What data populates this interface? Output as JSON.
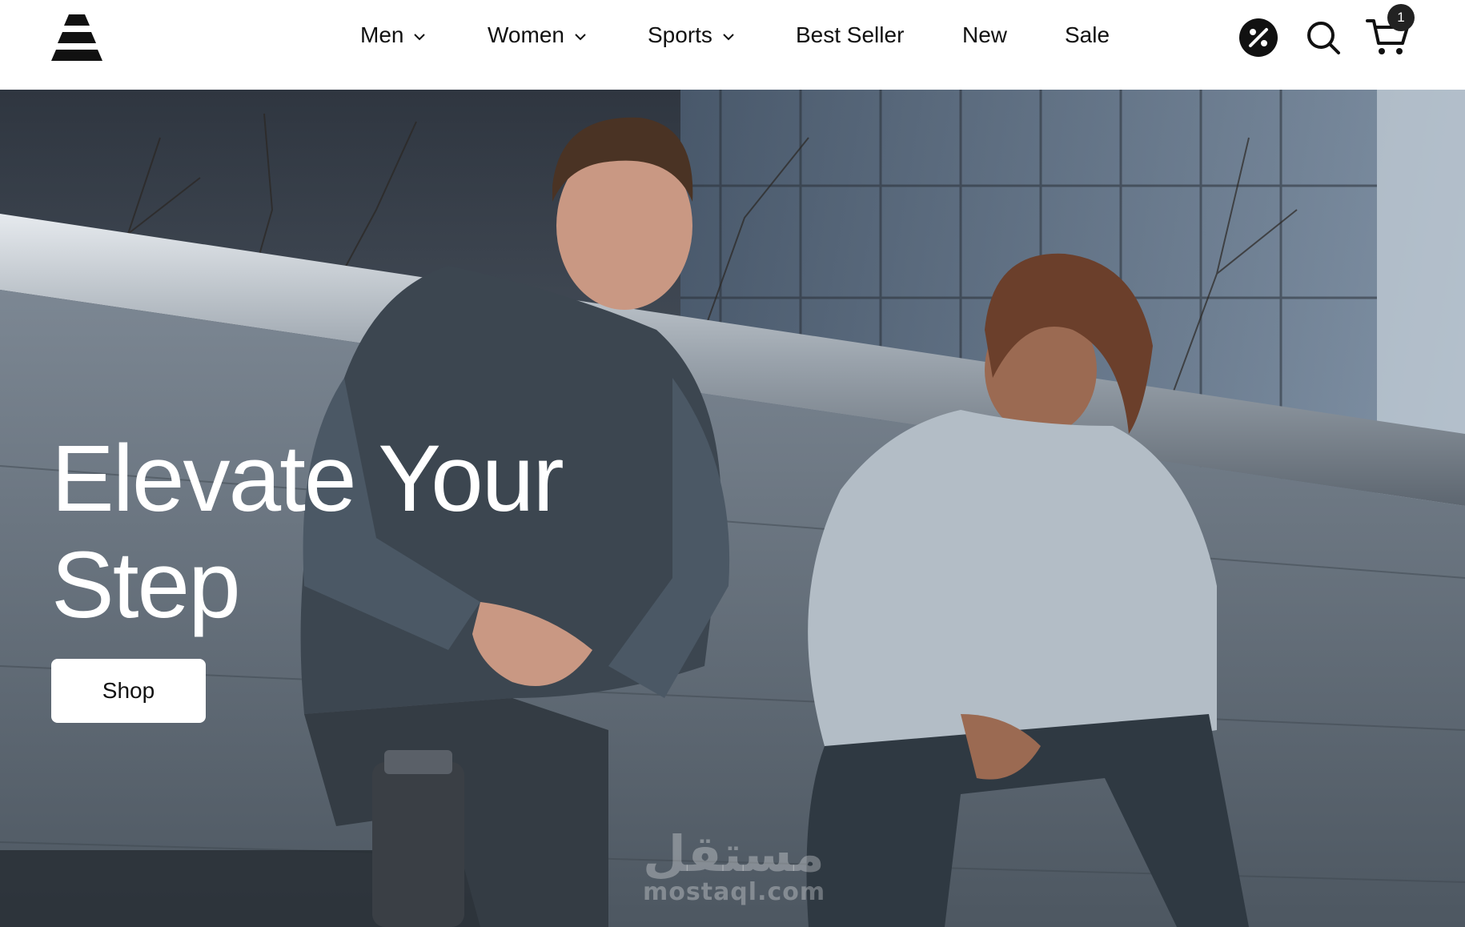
{
  "header": {
    "logo_icon": "triangle-stripe-logo-icon",
    "nav": [
      {
        "label": "Men",
        "has_dropdown": true
      },
      {
        "label": "Women",
        "has_dropdown": true
      },
      {
        "label": "Sports",
        "has_dropdown": true
      },
      {
        "label": "Best Seller",
        "has_dropdown": false
      },
      {
        "label": "New",
        "has_dropdown": false
      },
      {
        "label": "Sale",
        "has_dropdown": false
      }
    ],
    "tools": {
      "promo_icon": "discount-badge-icon",
      "search_icon": "search-icon",
      "cart_icon": "cart-icon",
      "cart_count": "1"
    }
  },
  "hero": {
    "title_line1": "Elevate Your",
    "title_line2": "Step",
    "cta_label": "Shop"
  },
  "watermark": {
    "arabic": "مستقل",
    "latin": "mostaql.com"
  },
  "colors": {
    "text": "#111111",
    "background": "#ffffff",
    "hero_text": "#ffffff",
    "badge": "#222222"
  }
}
